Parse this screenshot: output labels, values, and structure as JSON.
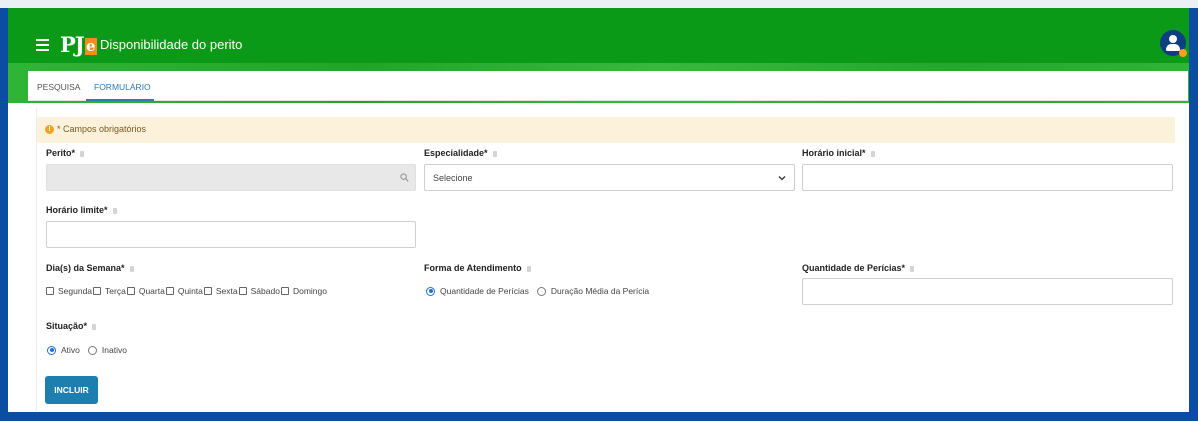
{
  "header": {
    "app_title": "Disponibilidade do perito",
    "logo_text_pj": "PJ",
    "logo_text_e": "e"
  },
  "tabs": [
    {
      "label": "PESQUISA",
      "active": false
    },
    {
      "label": "FORMULÁRIO",
      "active": true
    }
  ],
  "alert": {
    "text": "* Campos obrigatórios",
    "icon": "info-icon"
  },
  "form": {
    "perito": {
      "label": "Perito*",
      "value": "",
      "icon": "search-icon"
    },
    "especialidade": {
      "label": "Especialidade*",
      "selected": "Selecione"
    },
    "horario_inicial": {
      "label": "Horário inicial*",
      "value": ""
    },
    "horario_limite": {
      "label": "Horário limite*",
      "value": ""
    },
    "dias_semana": {
      "label": "Dia(s) da Semana*",
      "options": [
        "Segunda",
        "Terça",
        "Quarta",
        "Quinta",
        "Sexta",
        "Sábado",
        "Domingo"
      ]
    },
    "forma_atendimento": {
      "label": "Forma de Atendimento",
      "options": [
        "Quantidade de Perícias",
        "Duração Média da Perícia"
      ],
      "selected": "Quantidade de Perícias"
    },
    "quantidade_pericias": {
      "label": "Quantidade de Perícias*",
      "value": ""
    },
    "situacao": {
      "label": "Situação*",
      "options": [
        "Ativo",
        "Inativo"
      ],
      "selected": "Ativo"
    },
    "submit_label": "INCLUIR"
  },
  "colors": {
    "header_green": "#0a9a18",
    "frame_blue": "#0b4da2",
    "accent_blue": "#2a79b8",
    "button_blue": "#1d7fb0",
    "logo_orange": "#f28c1a",
    "alert_bg": "#fcf2dc"
  }
}
